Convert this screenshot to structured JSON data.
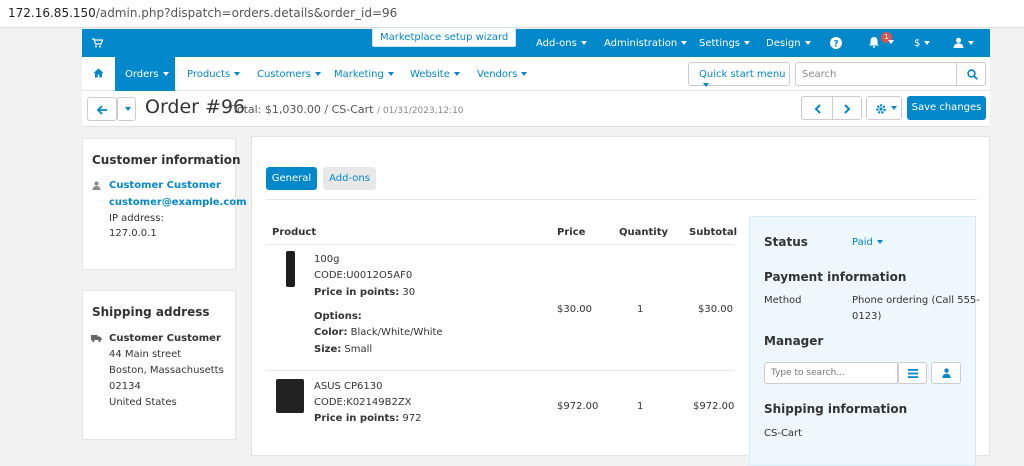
{
  "url": {
    "host": "172.16.85.150",
    "path": "/admin.php?dispatch=orders.details&order_id=96"
  },
  "topnav": {
    "wizard": "Marketplace setup wizard",
    "addons": "Add-ons",
    "administration": "Administration",
    "settings": "Settings",
    "design": "Design",
    "notif_count": "1",
    "currency": "$"
  },
  "secnav": {
    "orders": "Orders",
    "products": "Products",
    "customers": "Customers",
    "marketing": "Marketing",
    "website": "Website",
    "vendors": "Vendors",
    "quick_start": "Quick start menu",
    "search_placeholder": "Search"
  },
  "order": {
    "title": "Order #96",
    "total": "Total: $1,030.00 / CS-Cart",
    "date": "/ 01/31/2023,12:10",
    "save": "Save changes"
  },
  "customer": {
    "heading": "Customer information",
    "name": "Customer Customer",
    "email": "customer@example.com",
    "ip_label": "IP address:",
    "ip": "127.0.0.1"
  },
  "shipping_address": {
    "heading": "Shipping address",
    "name": "Customer Customer",
    "street": "44 Main street",
    "city": "Boston, Massachusetts",
    "zip": "02134",
    "country": "United States"
  },
  "tabs": {
    "general": "General",
    "addons": "Add-ons"
  },
  "table": {
    "headers": {
      "product": "Product",
      "price": "Price",
      "quantity": "Quantity",
      "subtotal": "Subtotal"
    },
    "rows": [
      {
        "name": "100g",
        "code": "CODE:U0012O5AF0",
        "points_label": "Price in points:",
        "points": "30",
        "options_label": "Options:",
        "color_label": "Color:",
        "color": "Black/White/White",
        "size_label": "Size:",
        "size": "Small",
        "price": "$30.00",
        "qty": "1",
        "subtotal": "$30.00"
      },
      {
        "name": "ASUS CP6130",
        "code": "CODE:K02149B2ZX",
        "points_label": "Price in points:",
        "points": "972",
        "price": "$972.00",
        "qty": "1",
        "subtotal": "$972.00"
      }
    ]
  },
  "status_panel": {
    "status_label": "Status",
    "status_value": "Paid",
    "payment_heading": "Payment information",
    "method_label": "Method",
    "method_line1": "Phone ordering (Call 555-",
    "method_line2": "0123)",
    "manager_heading": "Manager",
    "manager_placeholder": "Type to search...",
    "shipping_heading": "Shipping information",
    "shipping_value": "CS-Cart"
  },
  "colors": {
    "accent": "#0388cc",
    "panel": "#eef7fc",
    "badge": "#d9534f"
  },
  "icons": [
    "cart-icon",
    "help-icon",
    "bell-icon",
    "user-icon",
    "home-icon",
    "search-icon",
    "arrow-left-icon",
    "chevron-down-icon",
    "chevron-left-icon",
    "chevron-right-icon",
    "gear-icon",
    "person-icon",
    "truck-icon",
    "list-icon"
  ]
}
